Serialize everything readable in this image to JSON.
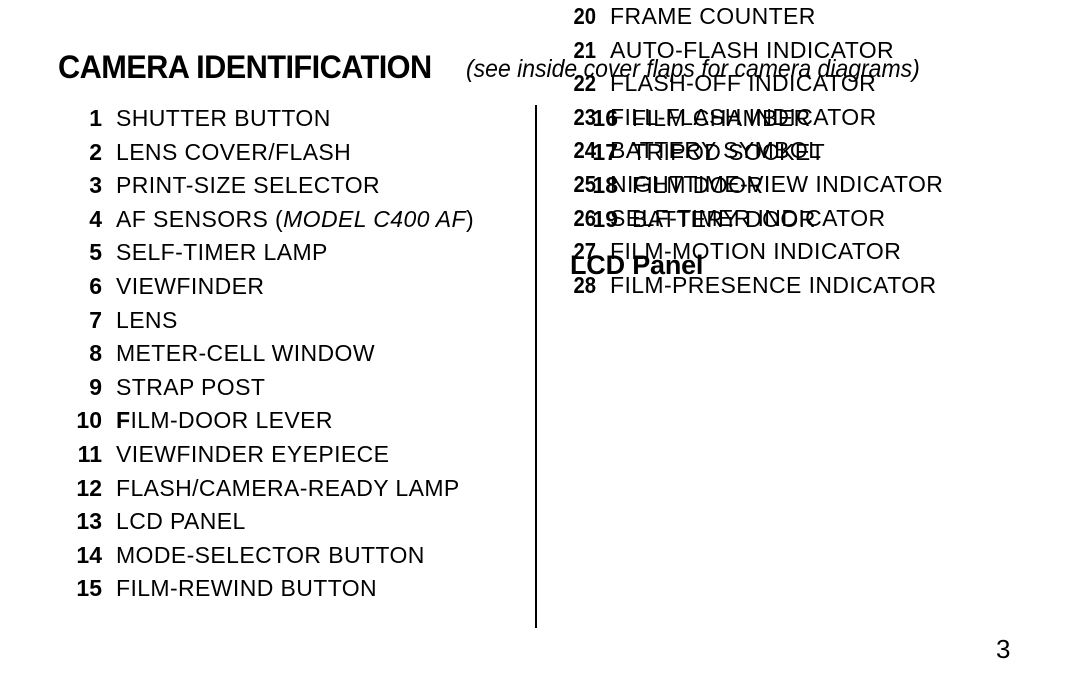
{
  "header": {
    "title": "CAMERA IDENTIFICATION",
    "note": "(see inside cover flaps for camera diagrams)"
  },
  "left_column": {
    "items": [
      {
        "num": "1",
        "label": "SHUTTER BUTTON"
      },
      {
        "num": "2",
        "label": "LENS COVER/FLASH"
      },
      {
        "num": "3",
        "label": "PRINT-SIZE SELECTOR"
      },
      {
        "num": "4",
        "label": "AF SENSORS (MODEL C400 AF)",
        "pre": "AF SENSORS (",
        "italic": "MODEL C400 AF",
        "post": ")"
      },
      {
        "num": "5",
        "label": "SELF-TIMER LAMP"
      },
      {
        "num": "6",
        "label": "VIEWFINDER"
      },
      {
        "num": "7",
        "label": "LENS"
      },
      {
        "num": "8",
        "label": "METER-CELL WINDOW"
      },
      {
        "num": "9",
        "label": "STRAP POST"
      },
      {
        "num": "10",
        "label": "FILM-DOOR LEVER",
        "lead": "F",
        "rest": "ILM-DOOR LEVER"
      },
      {
        "num": "11",
        "label": "VIEWFINDER EYEPIECE"
      },
      {
        "num": "12",
        "label": "FLASH/CAMERA-READY LAMP"
      },
      {
        "num": "13",
        "label": "LCD PANEL"
      },
      {
        "num": "14",
        "label": "MODE-SELECTOR BUTTON"
      },
      {
        "num": "15",
        "label": "FILM-REWIND BUTTON"
      }
    ]
  },
  "right_column": {
    "items": [
      {
        "num": "16",
        "label": "FILM CHAMBER"
      },
      {
        "num": "17",
        "label": "TRIPOD SOCKET"
      },
      {
        "num": "18",
        "label": "FILM DOOR"
      },
      {
        "num": "19",
        "label": "BATTERY DOOR"
      }
    ],
    "lcd_panel": {
      "heading": "LCD Panel",
      "items": [
        {
          "num": "20",
          "label": "FRAME COUNTER"
        },
        {
          "num": "21",
          "label": "AUTO-FLASH INDICATOR"
        },
        {
          "num": "22",
          "label": "FLASH-OFF INDICATOR"
        },
        {
          "num": "23",
          "label": "FILL-FLASH INDICATOR"
        },
        {
          "num": "24",
          "label": "BATTERY SYMBOL"
        },
        {
          "num": "25",
          "label": "NIGHTTIME-VIEW INDICATOR"
        },
        {
          "num": "26",
          "label": "SELF-TIMER INDICATOR"
        },
        {
          "num": "27",
          "label": "FILM-MOTION INDICATOR"
        },
        {
          "num": "28",
          "label": "FILM-PRESENCE INDICATOR"
        }
      ]
    }
  },
  "footer": {
    "page_number": "3"
  },
  "colors": {
    "background": "#ffffff",
    "text": "#000000",
    "divider": "#000000"
  }
}
